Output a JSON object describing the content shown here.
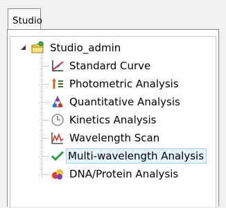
{
  "tab": {
    "label": "Studio"
  },
  "tree": {
    "root": {
      "label": "Studio_admin",
      "icon": "folder-user-icon",
      "expanded": true
    },
    "children": [
      {
        "label": "Standard Curve",
        "icon": "standard-curve-icon"
      },
      {
        "label": "Photometric Analysis",
        "icon": "photometric-icon"
      },
      {
        "label": "Quantitative Analysis",
        "icon": "quantitative-icon"
      },
      {
        "label": "Kinetics Analysis",
        "icon": "kinetics-icon"
      },
      {
        "label": "Wavelength Scan",
        "icon": "wavelength-scan-icon"
      },
      {
        "label": "Multi-wavelength Analysis",
        "icon": "checkmark-icon",
        "selected": true
      },
      {
        "label": "DNA/Protein Analysis",
        "icon": "dna-protein-icon"
      }
    ]
  },
  "colors": {
    "selection_bg": "#e5f3fb",
    "selection_border": "#9fd1ee",
    "check_green": "#2e9a3a"
  }
}
